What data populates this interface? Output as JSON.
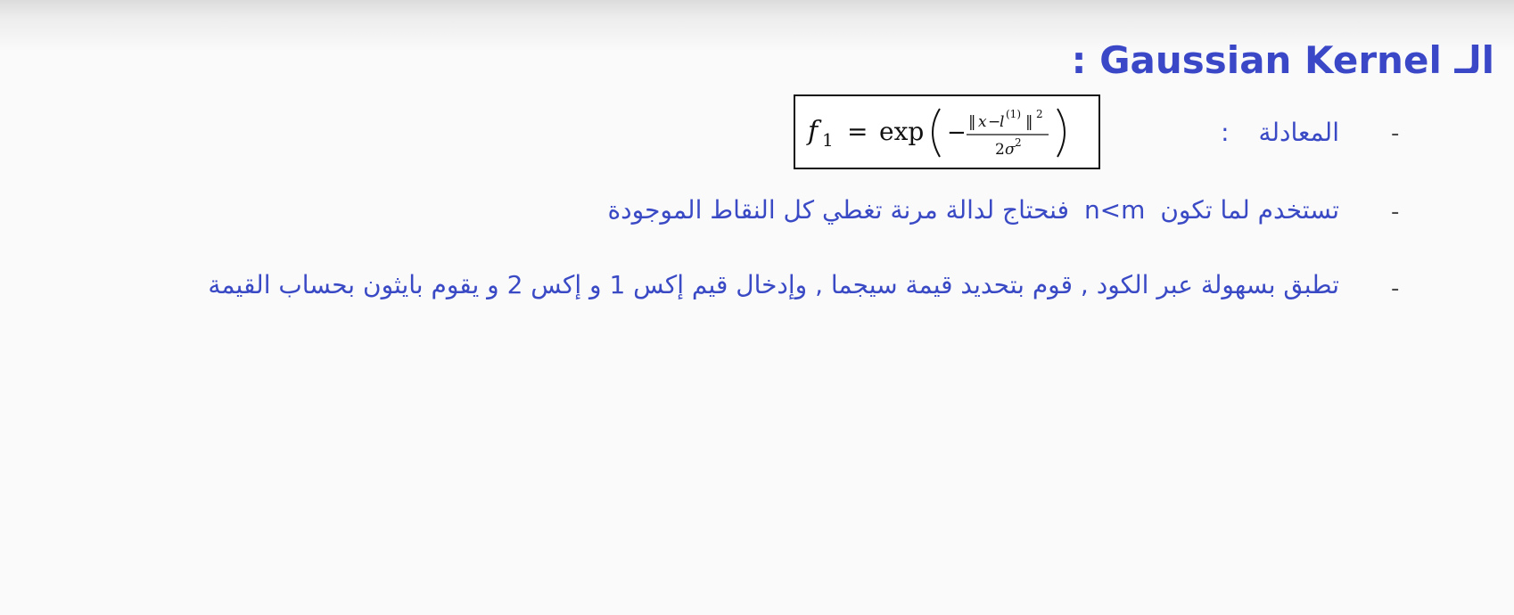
{
  "slide": {
    "title_prefix": "الـ",
    "title_term": "Gaussian Kernel",
    "title_colon": ":",
    "bullet_dash": "-",
    "colors": {
      "text": "#3a4ac5",
      "title": "#3a48c8",
      "background": "#fbfafb"
    }
  },
  "bullets": [
    {
      "label": "المعادلة",
      "colon": ":"
    },
    {
      "text_before": "تستخدم لما تكون",
      "term": "n<m",
      "text_after": "فنحتاج لدالة مرنة تغطي كل النقاط الموجودة"
    },
    {
      "text": "تطبق بسهولة عبر الكود , قوم بتحديد قيمة سيجما , وإدخال قيم إكس 1 و إكس 2 و يقوم بايثون بحساب القيمة"
    }
  ],
  "formula": {
    "lhs_f": "f",
    "lhs_sub": "1",
    "equals": "=",
    "func": "exp",
    "minus": "−",
    "num_open": "‖",
    "num_x": "x",
    "num_minus": "−",
    "num_l": "l",
    "num_sup_index": "(1)",
    "num_close": "‖",
    "num_sup_power": "2",
    "den_coeff": "2",
    "den_sigma": "σ",
    "den_power": "2"
  }
}
